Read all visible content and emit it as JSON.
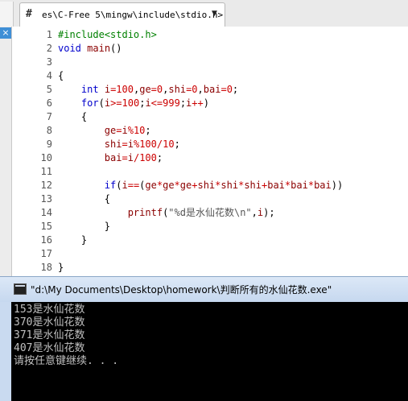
{
  "editor": {
    "tab_hash": "#",
    "tab_title": "es\\C-Free 5\\mingw\\include\\stdio.h>",
    "tab_dropdown": "▼",
    "gutter_mark": "×",
    "lines": [
      {
        "n": "1",
        "tokens": [
          {
            "c": "pp",
            "t": "#include<stdio.h>"
          }
        ]
      },
      {
        "n": "2",
        "tokens": [
          {
            "c": "kw",
            "t": "void"
          },
          {
            "c": "plain",
            "t": " "
          },
          {
            "c": "id",
            "t": "main"
          },
          {
            "c": "plain",
            "t": "()"
          }
        ]
      },
      {
        "n": "3",
        "tokens": []
      },
      {
        "n": "4",
        "tokens": [
          {
            "c": "plain",
            "t": "{"
          }
        ]
      },
      {
        "n": "5",
        "tokens": [
          {
            "c": "plain",
            "t": "    "
          },
          {
            "c": "kw",
            "t": "int"
          },
          {
            "c": "plain",
            "t": " "
          },
          {
            "c": "id",
            "t": "i"
          },
          {
            "c": "op",
            "t": "="
          },
          {
            "c": "num",
            "t": "100"
          },
          {
            "c": "plain",
            "t": ","
          },
          {
            "c": "id",
            "t": "ge"
          },
          {
            "c": "op",
            "t": "="
          },
          {
            "c": "num",
            "t": "0"
          },
          {
            "c": "plain",
            "t": ","
          },
          {
            "c": "id",
            "t": "shi"
          },
          {
            "c": "op",
            "t": "="
          },
          {
            "c": "num",
            "t": "0"
          },
          {
            "c": "plain",
            "t": ","
          },
          {
            "c": "id",
            "t": "bai"
          },
          {
            "c": "op",
            "t": "="
          },
          {
            "c": "num",
            "t": "0"
          },
          {
            "c": "plain",
            "t": ";"
          }
        ]
      },
      {
        "n": "6",
        "tokens": [
          {
            "c": "plain",
            "t": "    "
          },
          {
            "c": "kw",
            "t": "for"
          },
          {
            "c": "plain",
            "t": "("
          },
          {
            "c": "id",
            "t": "i"
          },
          {
            "c": "op",
            "t": ">="
          },
          {
            "c": "num",
            "t": "100"
          },
          {
            "c": "plain",
            "t": ";"
          },
          {
            "c": "id",
            "t": "i"
          },
          {
            "c": "op",
            "t": "<="
          },
          {
            "c": "num",
            "t": "999"
          },
          {
            "c": "plain",
            "t": ";"
          },
          {
            "c": "id",
            "t": "i"
          },
          {
            "c": "op",
            "t": "++"
          },
          {
            "c": "plain",
            "t": ")"
          }
        ]
      },
      {
        "n": "7",
        "tokens": [
          {
            "c": "plain",
            "t": "    {"
          }
        ]
      },
      {
        "n": "8",
        "tokens": [
          {
            "c": "plain",
            "t": "        "
          },
          {
            "c": "id",
            "t": "ge"
          },
          {
            "c": "op",
            "t": "="
          },
          {
            "c": "id",
            "t": "i"
          },
          {
            "c": "op",
            "t": "%"
          },
          {
            "c": "num",
            "t": "10"
          },
          {
            "c": "plain",
            "t": ";"
          }
        ]
      },
      {
        "n": "9",
        "tokens": [
          {
            "c": "plain",
            "t": "        "
          },
          {
            "c": "id",
            "t": "shi"
          },
          {
            "c": "op",
            "t": "="
          },
          {
            "c": "id",
            "t": "i"
          },
          {
            "c": "op",
            "t": "%"
          },
          {
            "c": "num",
            "t": "100"
          },
          {
            "c": "op",
            "t": "/"
          },
          {
            "c": "num",
            "t": "10"
          },
          {
            "c": "plain",
            "t": ";"
          }
        ]
      },
      {
        "n": "10",
        "tokens": [
          {
            "c": "plain",
            "t": "        "
          },
          {
            "c": "id",
            "t": "bai"
          },
          {
            "c": "op",
            "t": "="
          },
          {
            "c": "id",
            "t": "i"
          },
          {
            "c": "op",
            "t": "/"
          },
          {
            "c": "num",
            "t": "100"
          },
          {
            "c": "plain",
            "t": ";"
          }
        ]
      },
      {
        "n": "11",
        "tokens": []
      },
      {
        "n": "12",
        "tokens": [
          {
            "c": "plain",
            "t": "        "
          },
          {
            "c": "kw",
            "t": "if"
          },
          {
            "c": "plain",
            "t": "("
          },
          {
            "c": "id",
            "t": "i"
          },
          {
            "c": "op",
            "t": "=="
          },
          {
            "c": "plain",
            "t": "("
          },
          {
            "c": "id",
            "t": "ge"
          },
          {
            "c": "op",
            "t": "*"
          },
          {
            "c": "id",
            "t": "ge"
          },
          {
            "c": "op",
            "t": "*"
          },
          {
            "c": "id",
            "t": "ge"
          },
          {
            "c": "op",
            "t": "+"
          },
          {
            "c": "id",
            "t": "shi"
          },
          {
            "c": "op",
            "t": "*"
          },
          {
            "c": "id",
            "t": "shi"
          },
          {
            "c": "op",
            "t": "*"
          },
          {
            "c": "id",
            "t": "shi"
          },
          {
            "c": "op",
            "t": "+"
          },
          {
            "c": "id",
            "t": "bai"
          },
          {
            "c": "op",
            "t": "*"
          },
          {
            "c": "id",
            "t": "bai"
          },
          {
            "c": "op",
            "t": "*"
          },
          {
            "c": "id",
            "t": "bai"
          },
          {
            "c": "plain",
            "t": "))"
          }
        ]
      },
      {
        "n": "13",
        "tokens": [
          {
            "c": "plain",
            "t": "        {"
          }
        ]
      },
      {
        "n": "14",
        "tokens": [
          {
            "c": "plain",
            "t": "            "
          },
          {
            "c": "id",
            "t": "printf"
          },
          {
            "c": "plain",
            "t": "("
          },
          {
            "c": "str",
            "t": "\"%d是水仙花数\\n\""
          },
          {
            "c": "plain",
            "t": ","
          },
          {
            "c": "id",
            "t": "i"
          },
          {
            "c": "plain",
            "t": ");"
          }
        ]
      },
      {
        "n": "15",
        "tokens": [
          {
            "c": "plain",
            "t": "        }"
          }
        ]
      },
      {
        "n": "16",
        "tokens": [
          {
            "c": "plain",
            "t": "    }"
          }
        ]
      },
      {
        "n": "17",
        "tokens": []
      },
      {
        "n": "18",
        "tokens": [
          {
            "c": "plain",
            "t": "}"
          }
        ]
      }
    ]
  },
  "console": {
    "title": "\"d:\\My Documents\\Desktop\\homework\\判断所有的水仙花数.exe\"",
    "output": [
      "153是水仙花数",
      "370是水仙花数",
      "371是水仙花数",
      "407是水仙花数",
      "请按任意键继续. . ."
    ]
  }
}
